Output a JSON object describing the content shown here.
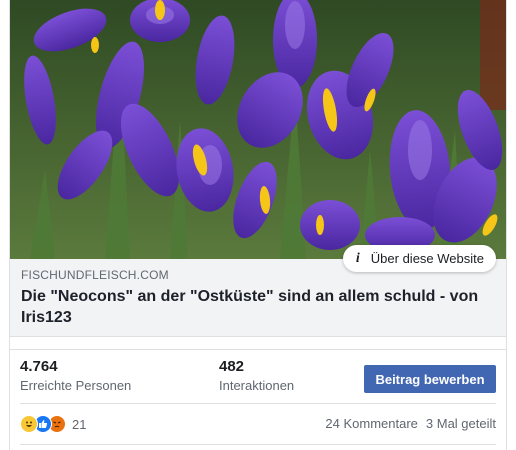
{
  "post": {
    "about_label": "Über diese Website",
    "domain": "FISCHUNDFLEISCH.COM",
    "headline": "Die \"Neocons\" an der \"Ostküste\" sind an allem schuld - von Iris123"
  },
  "stats": {
    "reach_value": "4.764",
    "reach_label": "Erreichte Personen",
    "engagement_value": "482",
    "engagement_label": "Interaktionen",
    "promote_label": "Beitrag bewerben"
  },
  "feedback": {
    "reactions": [
      "haha",
      "like",
      "angry"
    ],
    "reaction_count": "21",
    "comments": "24 Kommentare",
    "shares": "3 Mal geteilt"
  },
  "colors": {
    "promote_button": "#4267b2",
    "meta_background": "#f2f3f5",
    "iris_petal": "#6b3fc4",
    "iris_signal": "#f5c518"
  }
}
